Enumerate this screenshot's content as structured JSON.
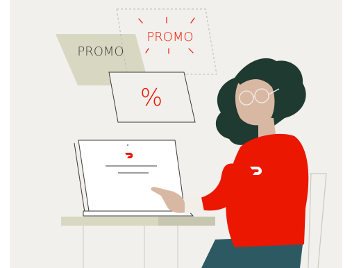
{
  "illustration": {
    "promo_tag_left": "PROMO",
    "promo_tag_right": "PROMO",
    "percent_symbol": "%",
    "brand_color": "#eb1700",
    "background_color": "#f1f0ec",
    "card_tan_color": "#d8d8c2",
    "hair_color": "#1f3a30",
    "skin_color": "#d9b8a3",
    "jeans_color": "#2d5a62",
    "icons": [
      "doordash-logo-icon",
      "sparkle-lines-icon"
    ]
  }
}
